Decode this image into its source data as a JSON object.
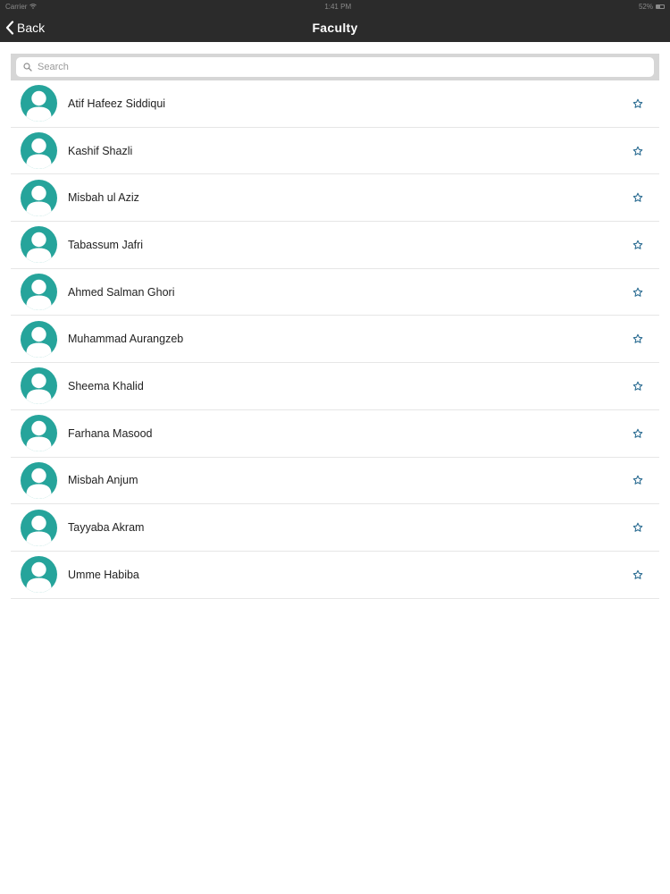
{
  "status_bar": {
    "carrier": "Carrier",
    "time": "1:41 PM",
    "battery": "52%",
    "wifi_icon": "wifi-icon",
    "battery_icon": "battery-icon"
  },
  "nav": {
    "back_label": "Back",
    "title": "Faculty"
  },
  "search": {
    "placeholder": "Search",
    "value": ""
  },
  "faculty": [
    {
      "name": "Atif Hafeez Siddiqui"
    },
    {
      "name": "Kashif Shazli"
    },
    {
      "name": "Misbah ul Aziz"
    },
    {
      "name": "Tabassum Jafri"
    },
    {
      "name": "Ahmed Salman Ghori"
    },
    {
      "name": "Muhammad Aurangzeb"
    },
    {
      "name": "Sheema Khalid"
    },
    {
      "name": "Farhana Masood"
    },
    {
      "name": "Misbah Anjum"
    },
    {
      "name": "Tayyaba Akram"
    },
    {
      "name": "Umme Habiba"
    }
  ],
  "colors": {
    "nav_background": "#2b2b2b",
    "avatar": "#26a49b",
    "star": "#2f6f94",
    "search_frame": "#d6d6d6"
  }
}
